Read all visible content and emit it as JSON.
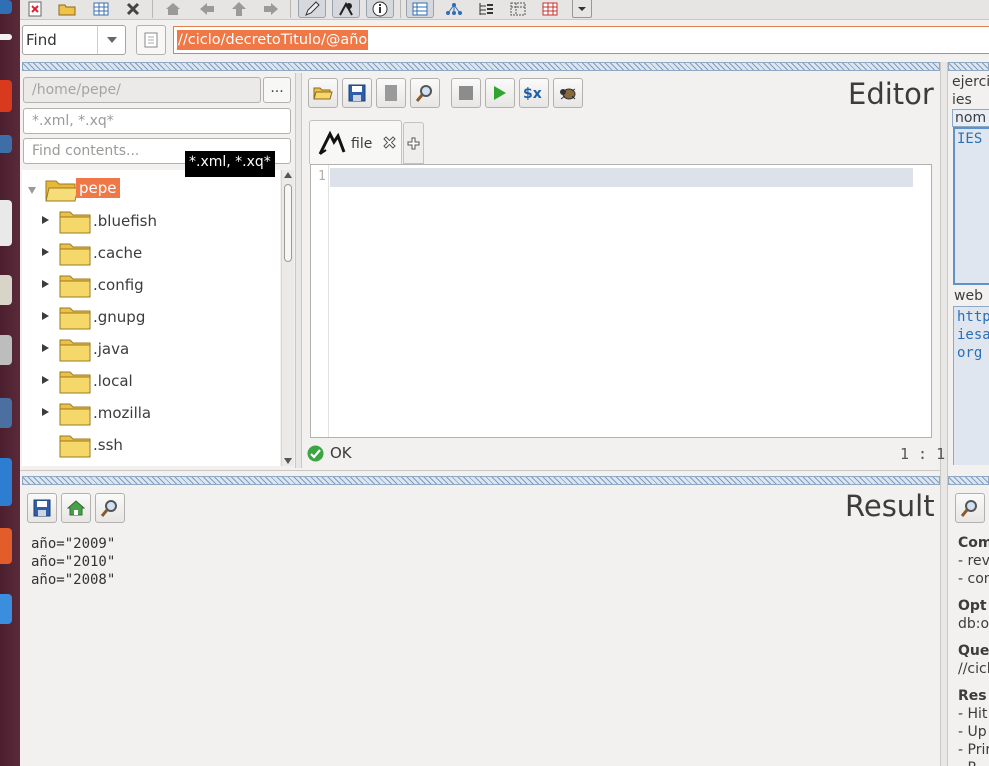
{
  "find_bar": {
    "mode": "Find",
    "query": "//ciclo/decretoTitulo/@año"
  },
  "explorer": {
    "path": "/home/pepe/",
    "browse_label": "...",
    "filter_placeholder": "*.xml, *.xq*",
    "contents_placeholder": "Find contents...",
    "tooltip": "*.xml, *.xq*",
    "tree": [
      {
        "name": "pepe",
        "expanded": true,
        "selected": true
      },
      {
        "name": ".bluefish"
      },
      {
        "name": ".cache"
      },
      {
        "name": ".config"
      },
      {
        "name": ".gnupg"
      },
      {
        "name": ".java"
      },
      {
        "name": ".local"
      },
      {
        "name": ".mozilla"
      },
      {
        "name": ".ssh"
      }
    ]
  },
  "editor": {
    "title": "Editor",
    "tab_label": "file",
    "line_number": "1",
    "status": "OK",
    "cursor": "1 : 1"
  },
  "info_panel": {
    "l1": "ejerci",
    "l2": "ies",
    "l3": "nom",
    "l4": "IES",
    "l5": "web",
    "l6": "http",
    "l7": "iesa",
    "l8": "org"
  },
  "result": {
    "title": "Result",
    "lines": [
      "año=\"2009\"",
      "año=\"2010\"",
      "año=\"2008\""
    ]
  },
  "query_info": {
    "compiling": "Com",
    "c1": "- rev",
    "c2": "- con",
    "optimized": "Opt",
    "o1": "db:o",
    "query": "Que",
    "q1": "//cicl",
    "result": "Res",
    "r1": "- Hit",
    "r2": "- Up",
    "r3": "- Prir",
    "r4": "- R"
  },
  "colors": {
    "selection": "#f07746",
    "splitter": "#7e9dc0",
    "launcher": "#4b1f2e"
  }
}
